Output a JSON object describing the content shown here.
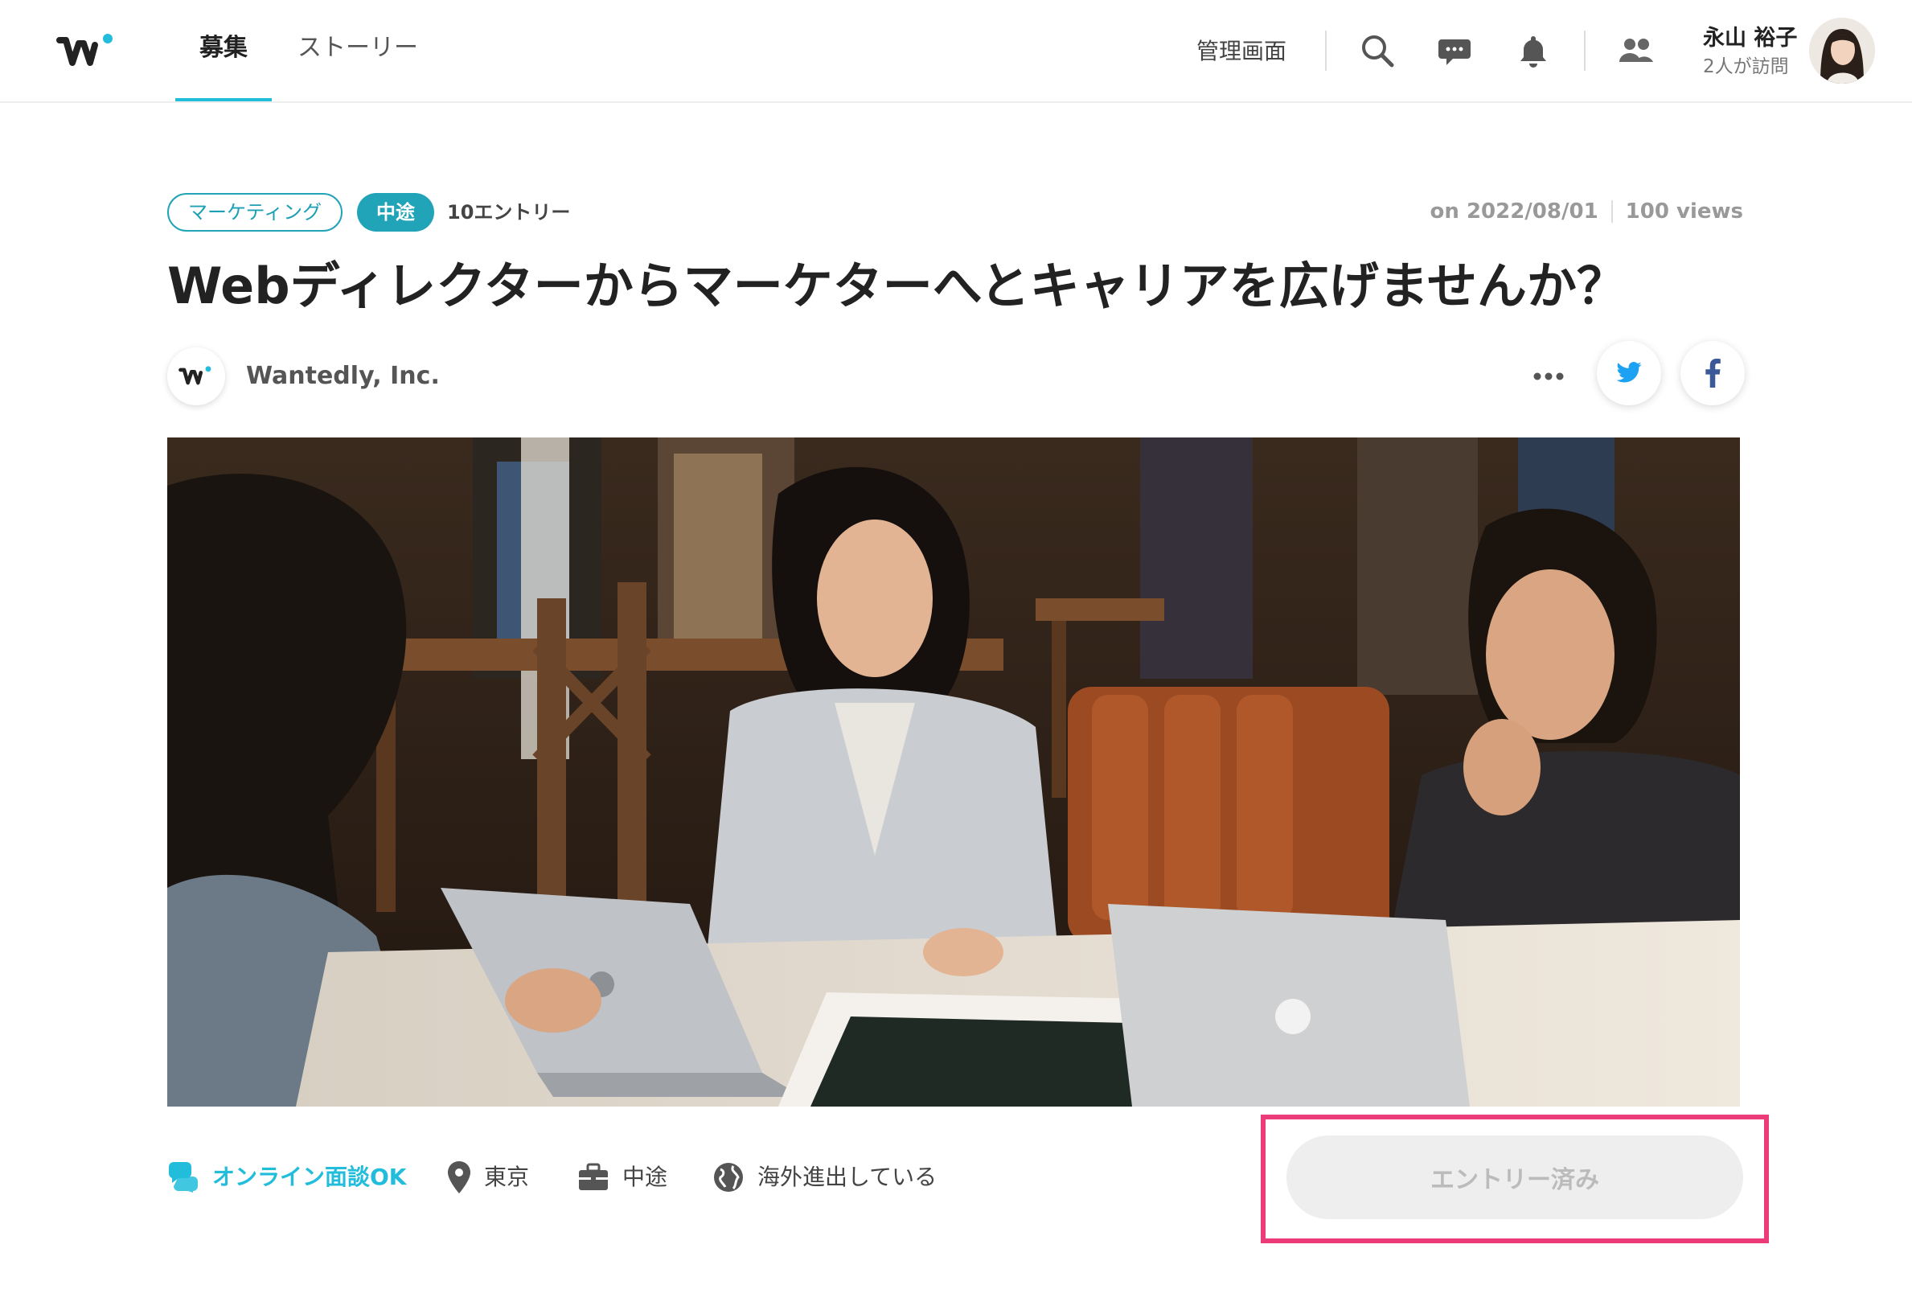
{
  "header": {
    "tabs": [
      {
        "label": "募集",
        "active": true
      },
      {
        "label": "ストーリー",
        "active": false
      }
    ],
    "admin_label": "管理画面",
    "icons": [
      "search-icon",
      "chat-icon",
      "bell-icon",
      "people-icon"
    ],
    "user": {
      "name": "永山 裕子",
      "visits": "2人が訪問"
    }
  },
  "post": {
    "tags": [
      "マーケティング",
      "中途"
    ],
    "entries": "10エントリー",
    "date": "on 2022/08/01",
    "views": "100 views",
    "title": "Webディレクターからマーケターへとキャリアを広げませんか？",
    "company": "Wantedly, Inc."
  },
  "info": {
    "online": "オンライン面談OK",
    "location": "東京",
    "employment": "中途",
    "overseas": "海外進出している"
  },
  "entry_button": {
    "label": "エントリー済み",
    "disabled": true
  },
  "colors": {
    "accent": "#21bddb",
    "tag": "#21a3b8",
    "highlight": "#ec3b79",
    "twitter": "#1da1f2",
    "facebook": "#3b5998"
  }
}
